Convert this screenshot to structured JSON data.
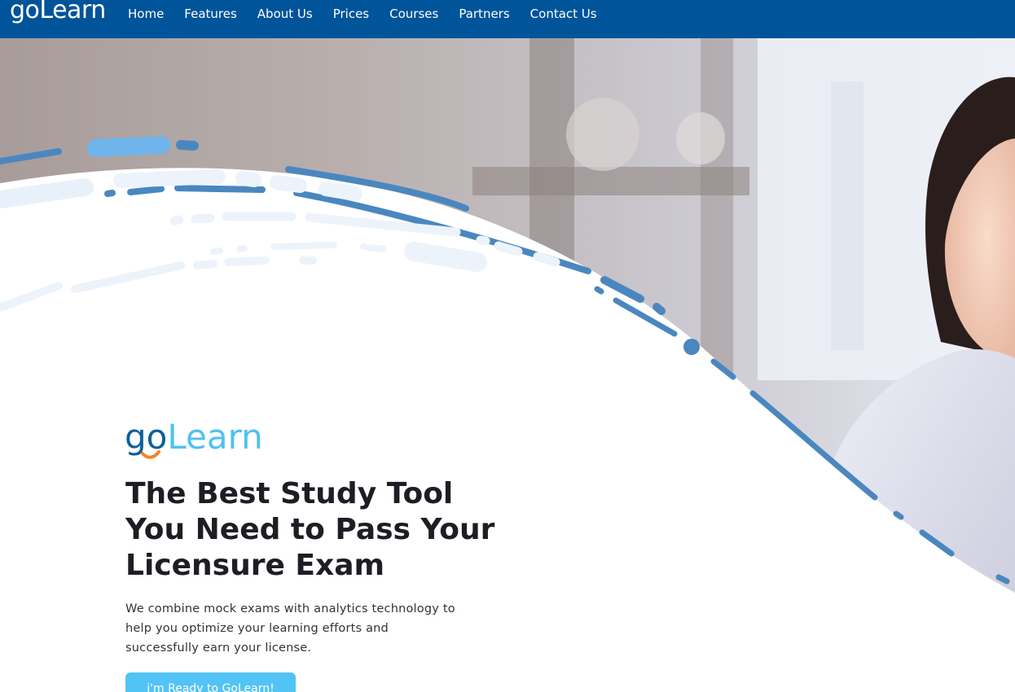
{
  "nav": {
    "logo": "goLearn",
    "items": [
      {
        "label": "Home"
      },
      {
        "label": "Features"
      },
      {
        "label": "About Us"
      },
      {
        "label": "Prices"
      },
      {
        "label": "Courses"
      },
      {
        "label": "Partners"
      },
      {
        "label": "Contact Us"
      }
    ]
  },
  "hero": {
    "brand_go": "go",
    "brand_learn": "Learn",
    "headline": "The Best Study Tool You Need to Pass Your Licensure Exam",
    "description": "We combine mock exams with analytics technology to help you optimize your learning efforts and successfully earn your license.",
    "cta_label": "i'm Ready to GoLearn!"
  },
  "colors": {
    "navbar": "#00549a",
    "brand_dark": "#0f5f9c",
    "brand_light": "#4fc1f1",
    "accent_orange": "#f0832a",
    "cta": "#52c3f5",
    "swoosh": "#4a87bf"
  }
}
